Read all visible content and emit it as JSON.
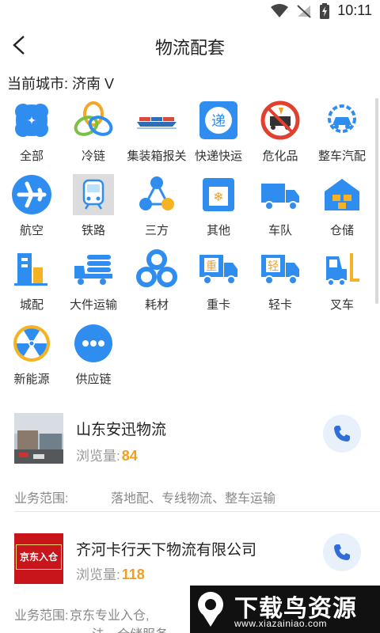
{
  "status_bar": {
    "time": "10:11",
    "icons": [
      "wifi-icon",
      "signal-off-icon",
      "battery-charging-icon"
    ]
  },
  "app_bar": {
    "title": "物流配套",
    "back_icon": "back-arrow-icon"
  },
  "city_selector": {
    "label": "当前城市: 济南 V"
  },
  "categories": [
    {
      "label": "全部",
      "icon": "all-icon"
    },
    {
      "label": "冷链",
      "icon": "cold-chain-icon"
    },
    {
      "label": "集装箱报关",
      "icon": "container-ship-icon"
    },
    {
      "label": "快递快运",
      "icon": "express-icon"
    },
    {
      "label": "危化品",
      "icon": "hazardous-icon"
    },
    {
      "label": "整车汽配",
      "icon": "auto-parts-icon"
    },
    {
      "label": "航空",
      "icon": "airplane-icon"
    },
    {
      "label": "铁路",
      "icon": "train-icon"
    },
    {
      "label": "三方",
      "icon": "third-party-icon"
    },
    {
      "label": "其他",
      "icon": "other-icon"
    },
    {
      "label": "车队",
      "icon": "fleet-truck-icon"
    },
    {
      "label": "仓储",
      "icon": "warehouse-icon"
    },
    {
      "label": "城配",
      "icon": "city-delivery-icon"
    },
    {
      "label": "大件运输",
      "icon": "heavy-cargo-icon"
    },
    {
      "label": "耗材",
      "icon": "consumables-icon"
    },
    {
      "label": "重卡",
      "icon": "heavy-truck-icon"
    },
    {
      "label": "轻卡",
      "icon": "light-truck-icon"
    },
    {
      "label": "叉车",
      "icon": "forklift-icon"
    },
    {
      "label": "新能源",
      "icon": "new-energy-icon"
    },
    {
      "label": "供应链",
      "icon": "supply-chain-icon"
    }
  ],
  "listings": [
    {
      "name": "山东安迅物流",
      "views_label": "浏览量:",
      "views": "84",
      "scope_label": "业务范围:",
      "scope": "落地配、专线物流、整车运输"
    },
    {
      "name": "齐河卡行天下物流有限公司",
      "views_label": "浏览量:",
      "views": "118",
      "scope_label": "业务范围:",
      "scope": "京东专业入仓,",
      "thumb_text": "京东入仓",
      "scope_line2": "法、仓储服务"
    }
  ],
  "watermark": {
    "title": "下载鸟资源",
    "url": "www.xiazainiao.com"
  },
  "colors": {
    "accent_blue": "#2f8df0",
    "orange": "#f0a021",
    "phone_bg": "#e8f0fb"
  }
}
